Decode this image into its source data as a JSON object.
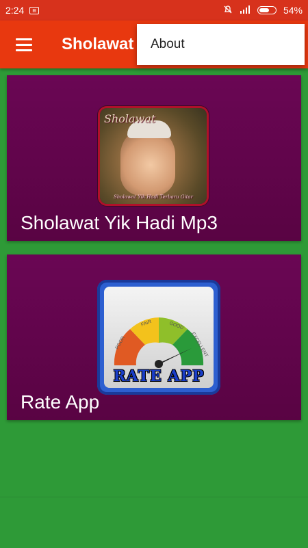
{
  "status_bar": {
    "time": "2:24",
    "notification_icon": "sim-card-icon",
    "battery": "54%",
    "icons": [
      "notification-off-icon",
      "signal-icon",
      "battery-icon"
    ]
  },
  "toolbar": {
    "title": "Sholawat",
    "menu_icon": "hamburger-menu-icon"
  },
  "overflow_menu": {
    "items": [
      {
        "label": "About"
      }
    ]
  },
  "cards": [
    {
      "label": "Sholawat Yik Hadi Mp3",
      "image_text": "Sholawat",
      "image_caption": "Sholawat Yik Hadi Terbaru Gitar"
    },
    {
      "label": "Rate App",
      "image_text": "RATE APP",
      "gauge_labels": [
        "POOR",
        "FAIR",
        "GOOD",
        "EXCELLENT"
      ]
    }
  ],
  "colors": {
    "status_bar": "#d7321c",
    "toolbar": "#e8380f",
    "card": "#6a0654",
    "background": "#2e9a37"
  }
}
